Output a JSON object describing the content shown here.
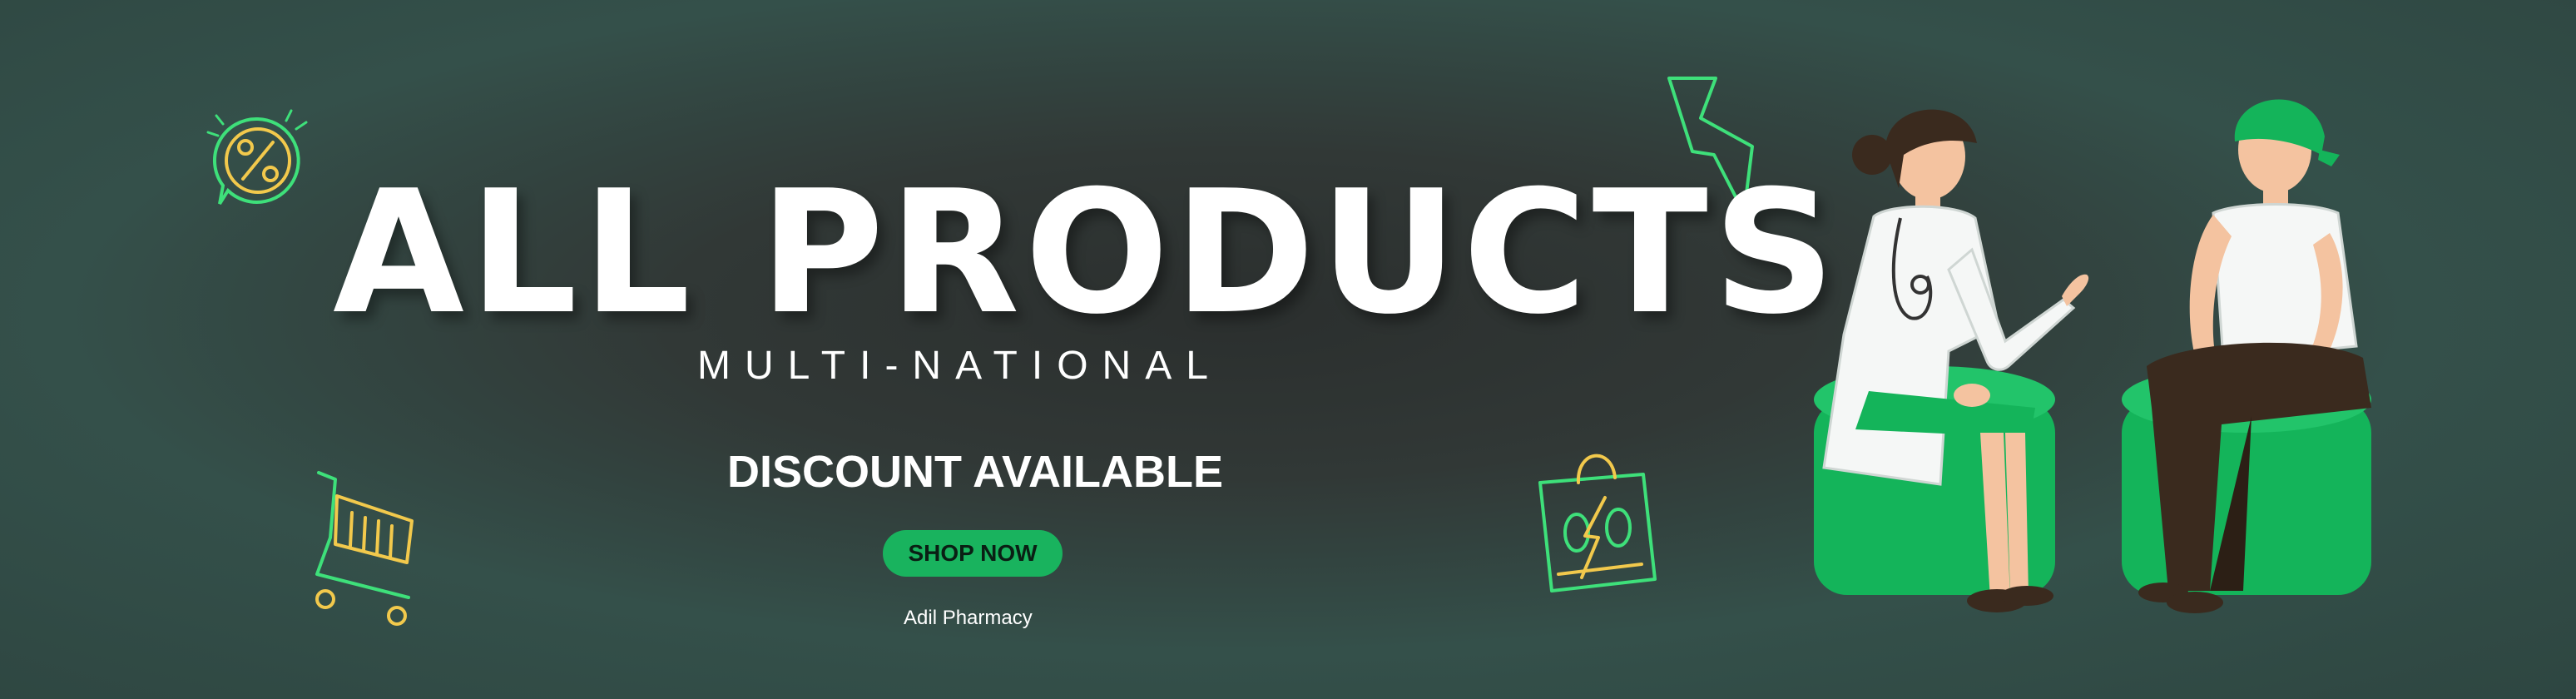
{
  "banner": {
    "title": "ALL PRODUCTS",
    "subtitle": "MULTI-NATIONAL",
    "tagline": "DISCOUNT AVAILABLE",
    "cta_label": "SHOP NOW",
    "brand": "Adil Pharmacy"
  },
  "icons": {
    "percent_badge": "percent-badge-icon",
    "shopping_cart": "shopping-cart-icon",
    "lightning": "lightning-bolt-icon",
    "discount_bag": "discount-bag-icon"
  },
  "colors": {
    "background": "#2e4641",
    "accent_green": "#19b35e",
    "neon_green": "#3ee07a",
    "neon_yellow": "#f2c94c",
    "text": "#ffffff"
  }
}
